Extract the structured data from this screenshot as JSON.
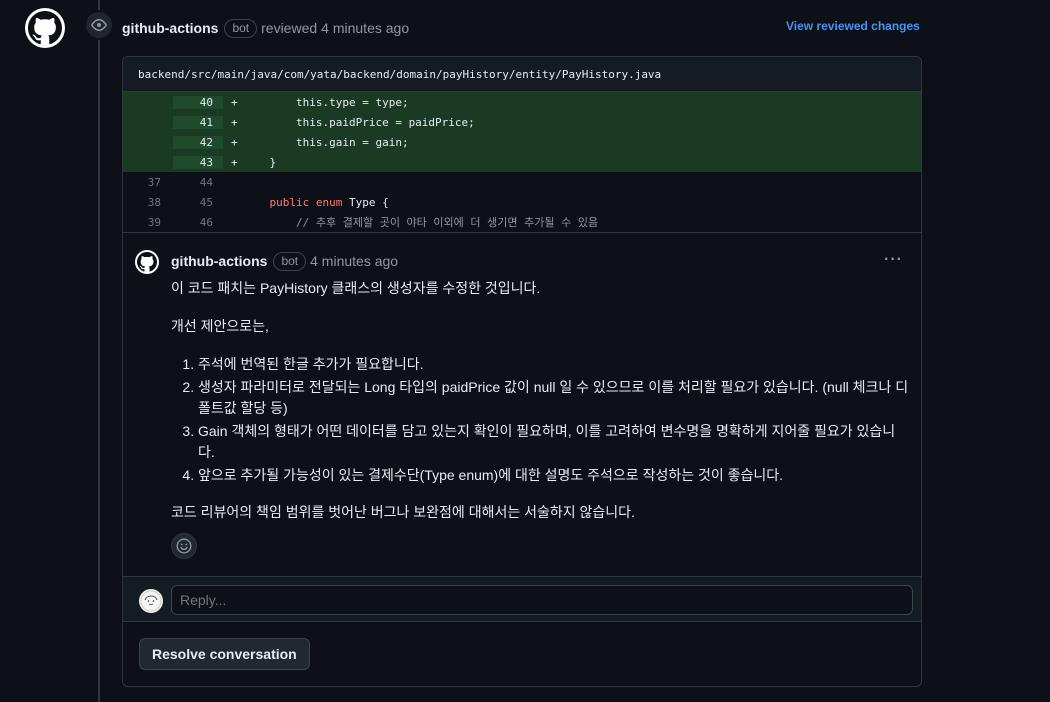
{
  "review": {
    "author": "github-actions",
    "badge": "bot",
    "action": "reviewed",
    "time": "4 minutes ago",
    "view_changes": "View reviewed changes"
  },
  "file": {
    "path": "backend/src/main/java/com/yata/backend/domain/payHistory/entity/PayHistory.java"
  },
  "diff_lines": [
    {
      "old": "",
      "new": "40",
      "mark": "+",
      "code": "        this.type = type;",
      "added": true
    },
    {
      "old": "",
      "new": "41",
      "mark": "+",
      "code": "        this.paidPrice = paidPrice;",
      "added": true
    },
    {
      "old": "",
      "new": "42",
      "mark": "+",
      "code": "        this.gain = gain;",
      "added": true
    },
    {
      "old": "",
      "new": "43",
      "mark": "+",
      "code": "    }",
      "added": true
    },
    {
      "old": "37",
      "new": "44",
      "mark": "",
      "code": "",
      "added": false
    },
    {
      "old": "38",
      "new": "45",
      "mark": "",
      "kw": "public enum",
      "code": " Type {",
      "added": false
    },
    {
      "old": "39",
      "new": "46",
      "mark": "",
      "comment": "// 추후 결제할 곳이 야타 이외에 더 생기면 추가될 수 있음",
      "code": "",
      "added": false
    }
  ],
  "comment": {
    "author": "github-actions",
    "badge": "bot",
    "time": "4 minutes ago",
    "menu": "···",
    "intro": "이 코드 패치는 PayHistory 클래스의 생성자를 수정한 것입니다.",
    "suggest_heading": "개선 제안으로는,",
    "items": [
      "주석에 번역된 한글 추가가 필요합니다.",
      "생성자 파라미터로 전달되는 Long 타입의 paidPrice 값이 null 일 수 있으므로 이를 처리할 필요가 있습니다. (null 체크나 디폴트값 할당 등)",
      "Gain 객체의 형태가 어떤 데이터를 담고 있는지 확인이 필요하며, 이를 고려하여 변수명을 명확하게 지어줄 필요가 있습니다.",
      "앞으로 추가될 가능성이 있는 결제수단(Type enum)에 대한 설명도 주석으로 작성하는 것이 좋습니다."
    ],
    "outro": "코드 리뷰어의 책임 범위를 벗어난 버그나 보완점에 대해서는 서술하지 않습니다."
  },
  "reply": {
    "placeholder": "Reply..."
  },
  "actions": {
    "resolve_label": "Resolve conversation"
  },
  "colors": {
    "background": "#0d1117",
    "added_line": "#1a3a24",
    "link": "#4493f8",
    "keyword": "#ff7b72"
  }
}
